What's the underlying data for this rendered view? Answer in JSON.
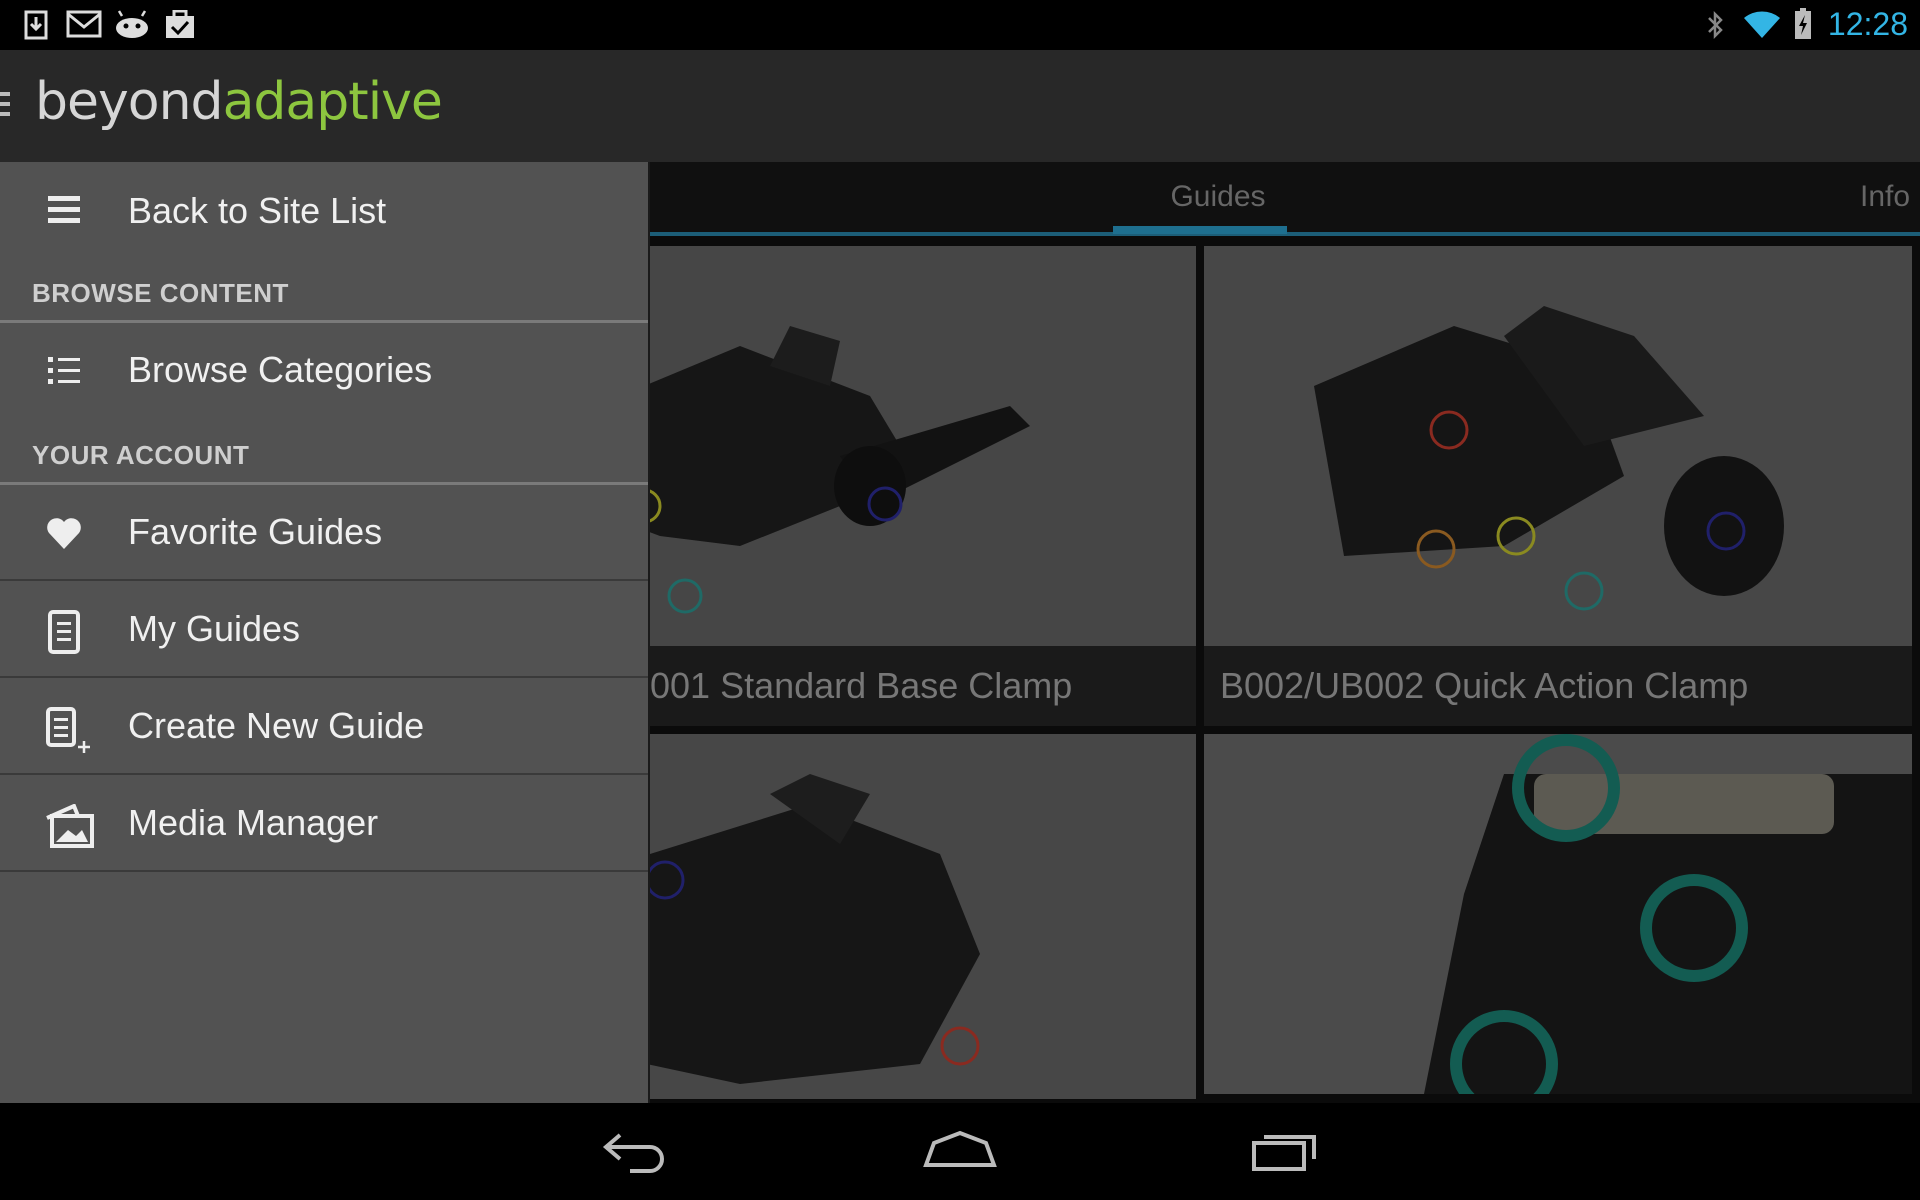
{
  "status_bar": {
    "time": "12:28",
    "left_icons": [
      "download-icon",
      "gmail-icon",
      "android-icon",
      "task-check-icon"
    ],
    "right_icons": [
      "bluetooth-icon",
      "wifi-icon",
      "battery-charging-icon"
    ]
  },
  "action_bar": {
    "logo_part1": "beyond",
    "logo_part2": "adaptive",
    "logo_part2_color": "#8dc63f"
  },
  "tabs": [
    {
      "label": "Guides",
      "selected": true
    },
    {
      "label": "Info",
      "selected": false
    }
  ],
  "guides": [
    {
      "title": "001 Standard Base Clamp"
    },
    {
      "title": "B002/UB002 Quick Action Clamp"
    },
    {
      "title": ""
    },
    {
      "title": ""
    }
  ],
  "drawer": {
    "back_label": "Back to Site List",
    "browse_header": "BROWSE CONTENT",
    "browse_categories": "Browse Categories",
    "account_header": "YOUR ACCOUNT",
    "favorite_guides": "Favorite Guides",
    "my_guides": "My Guides",
    "create_new_guide": "Create New Guide",
    "media_manager": "Media Manager"
  },
  "nav_bar": {
    "buttons": [
      "back-icon",
      "home-icon",
      "recent-apps-icon"
    ]
  },
  "colors": {
    "accent": "#33b5e5",
    "brand_green": "#8dc63f",
    "drawer_bg": "#525252"
  }
}
